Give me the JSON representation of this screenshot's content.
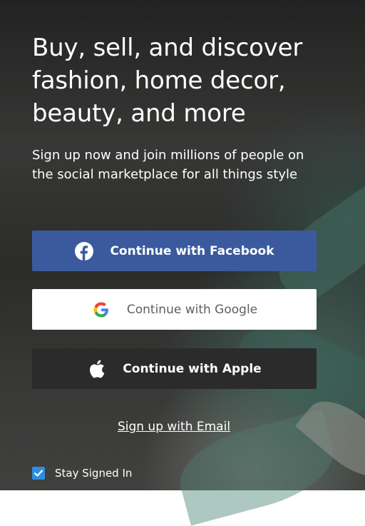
{
  "hero": {
    "headline_line1": "Buy, sell, and discover",
    "headline_line2": "fashion, home decor,",
    "headline_line3": "beauty, and more",
    "subtitle": "Sign up now and join millions of people on the social marketplace for all things style"
  },
  "buttons": {
    "facebook_label": "Continue with Facebook",
    "google_label": "Continue with Google",
    "apple_label": "Continue with Apple",
    "email_link": "Sign up with Email"
  },
  "stay_signed_in": {
    "label": "Stay Signed In",
    "checked": true
  },
  "colors": {
    "facebook": "#3b5a9e",
    "apple": "#2b2b2b",
    "google_bg": "#ffffff",
    "checkbox": "#2f8de0"
  },
  "icons": {
    "facebook": "facebook-icon",
    "google": "google-icon",
    "apple": "apple-icon",
    "check": "check-icon"
  }
}
